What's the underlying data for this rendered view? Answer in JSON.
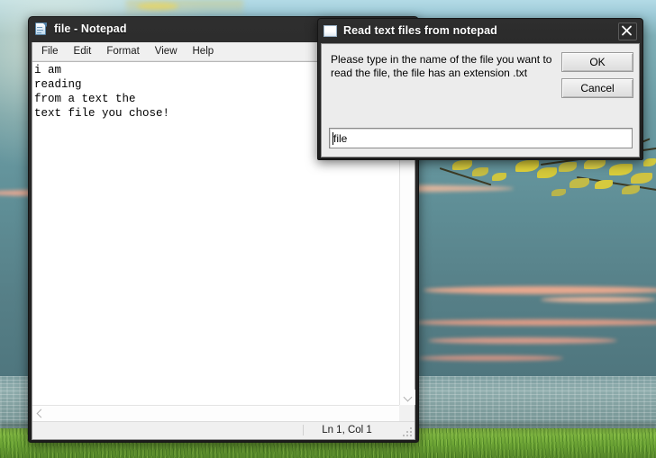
{
  "desktop": {
    "wallpaper_name": "lake-sunset-wallpaper",
    "colors": {
      "sky_top": "#b3dbe6",
      "sky_bottom": "#4e757d",
      "cloud_pink": "#e8a48c",
      "water": "#8fadad",
      "grass": "#7cb23f",
      "leaf_yellow": "#e3d43c"
    }
  },
  "notepad": {
    "title": "file - Notepad",
    "icon": "notepad-document-icon",
    "menu": [
      {
        "label": "File"
      },
      {
        "label": "Edit"
      },
      {
        "label": "Format"
      },
      {
        "label": "View"
      },
      {
        "label": "Help"
      }
    ],
    "document_text": "i am\nreading\nfrom a text the\ntext file you chose!",
    "status": "Ln 1, Col 1",
    "scrollbars": {
      "vertical_down_arrow": "chevron-down-icon",
      "horizontal_left_arrow": "chevron-left-icon",
      "horizontal_right_arrow": "chevron-right-icon"
    }
  },
  "dialog": {
    "title": "Read text files from notepad",
    "icon": "window-icon",
    "close_icon": "close-icon",
    "prompt": "Please type in the name of the file you want to read the file, the file has an extension .txt",
    "buttons": {
      "ok": "OK",
      "cancel": "Cancel"
    },
    "input": {
      "value": "file",
      "placeholder": ""
    }
  }
}
